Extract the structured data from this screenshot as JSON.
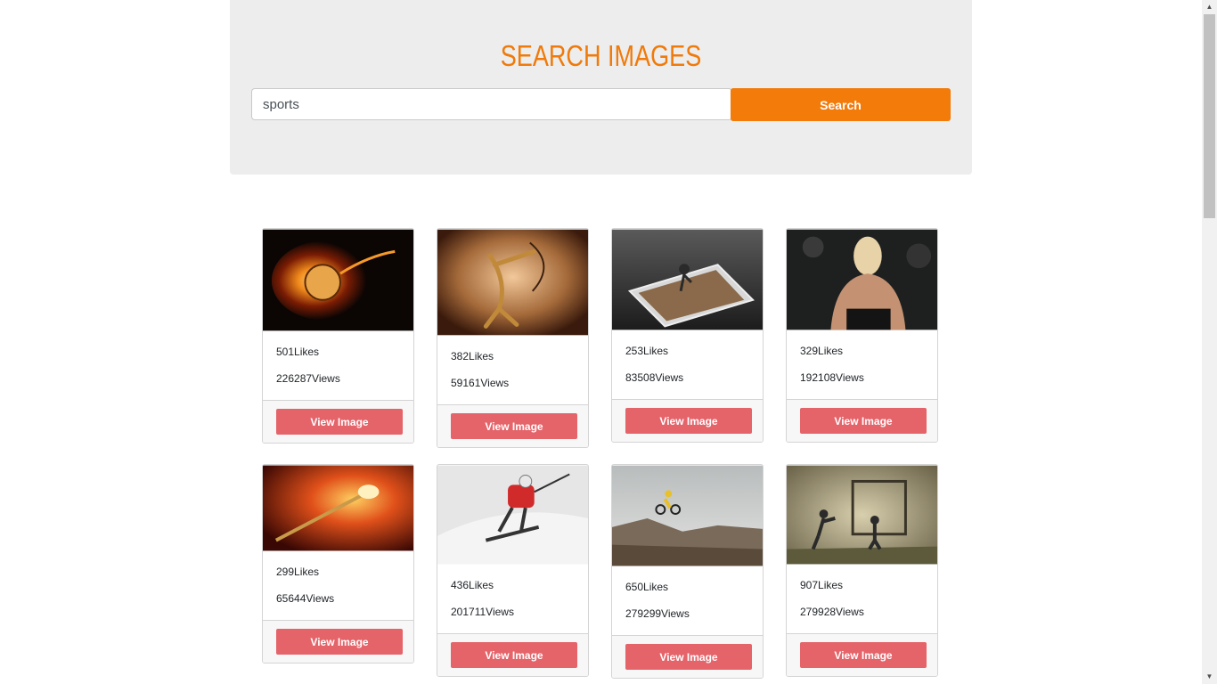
{
  "header": {
    "title": "SEARCH IMAGES",
    "search_value": "sports",
    "search_button_label": "Search"
  },
  "cards": [
    {
      "likes": "501Likes",
      "views": "226287Views",
      "button": "View Image",
      "image": "fireball-soccer-ball"
    },
    {
      "likes": "382Likes",
      "views": "59161Views",
      "button": "View Image",
      "image": "golden-archer-figure"
    },
    {
      "likes": "253Likes",
      "views": "83508Views",
      "button": "View Image",
      "image": "phone-with-athlete"
    },
    {
      "likes": "329Likes",
      "views": "192108Views",
      "button": "View Image",
      "image": "athlete-back"
    },
    {
      "likes": "299Likes",
      "views": "65644Views",
      "button": "View Image",
      "image": "flaming-dart"
    },
    {
      "likes": "436Likes",
      "views": "201711Views",
      "button": "View Image",
      "image": "skier-in-snow"
    },
    {
      "likes": "650Likes",
      "views": "279299Views",
      "button": "View Image",
      "image": "bmx-jump"
    },
    {
      "likes": "907Likes",
      "views": "279928Views",
      "button": "View Image",
      "image": "kids-playing-football"
    }
  ],
  "colors": {
    "accent": "#f27b0a",
    "view_button": "#e4646a",
    "panel": "#ededed"
  }
}
